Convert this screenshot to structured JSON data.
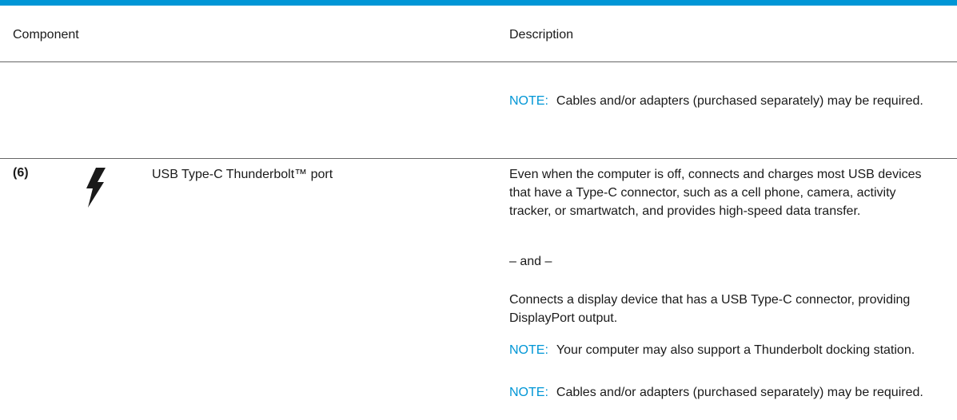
{
  "table": {
    "header": {
      "component": "Component",
      "description": "Description"
    },
    "rows": [
      {
        "note": {
          "label": "NOTE:",
          "text": "Cables and/or adapters (purchased separately) may be required."
        }
      },
      {
        "number": "(6)",
        "icon": "thunderbolt-icon",
        "component": "USB Type-C Thunderbolt™ port",
        "description": {
          "p1": "Even when the computer is off, connects and charges most USB devices that have a Type-C connector, such as a cell phone, camera, activity tracker, or smartwatch, and provides high-speed data transfer.",
          "p2": "– and –",
          "p3": "Connects a display device that has a USB Type-C connector, providing DisplayPort output.",
          "note1_label": "NOTE:",
          "note1_text": "Your computer may also support a Thunderbolt docking station.",
          "note2_label": "NOTE:",
          "note2_text": "Cables and/or adapters (purchased separately) may be required."
        }
      }
    ]
  },
  "colors": {
    "accent": "#0096d6",
    "text": "#1a1a1a",
    "rule": "#666666"
  }
}
